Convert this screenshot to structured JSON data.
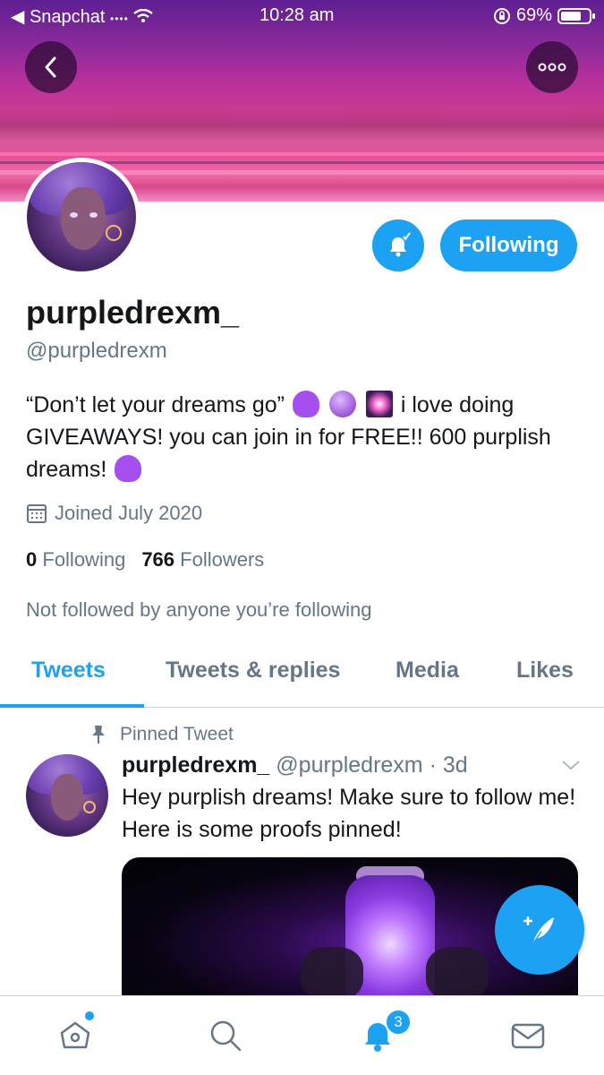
{
  "status_bar": {
    "back_app": "Snapchat",
    "time": "10:28 am",
    "battery": "69%"
  },
  "profile": {
    "display_name": "purpledrexm_",
    "handle": "@purpledrexm",
    "bio_part1": "“Don’t let your dreams go”",
    "bio_part2": "i love doing GIVEAWAYS! you can join in for FREE!! 600 purplish dreams!",
    "joined": "Joined July 2020",
    "following_count": "0",
    "following_label": "Following",
    "followers_count": "766",
    "followers_label": "Followers",
    "not_followed": "Not followed by anyone you’re following",
    "follow_button": "Following"
  },
  "tabs": [
    {
      "label": "Tweets",
      "active": true
    },
    {
      "label": "Tweets & replies",
      "active": false
    },
    {
      "label": "Media",
      "active": false
    },
    {
      "label": "Likes",
      "active": false
    }
  ],
  "tweet": {
    "pinned_label": "Pinned Tweet",
    "author_name": "purpledrexm_",
    "author_handle": "@purpledrexm",
    "time": "· 3d",
    "text": "Hey purplish dreams! Make sure to follow me! Here is some proofs pinned!"
  },
  "bottom_nav": {
    "notification_badge": "3",
    "icons": [
      "home-icon",
      "search-icon",
      "bell-icon",
      "mail-icon"
    ]
  },
  "colors": {
    "accent": "#1da1f2",
    "secondary_text": "#657786",
    "primary_text": "#14171a"
  }
}
